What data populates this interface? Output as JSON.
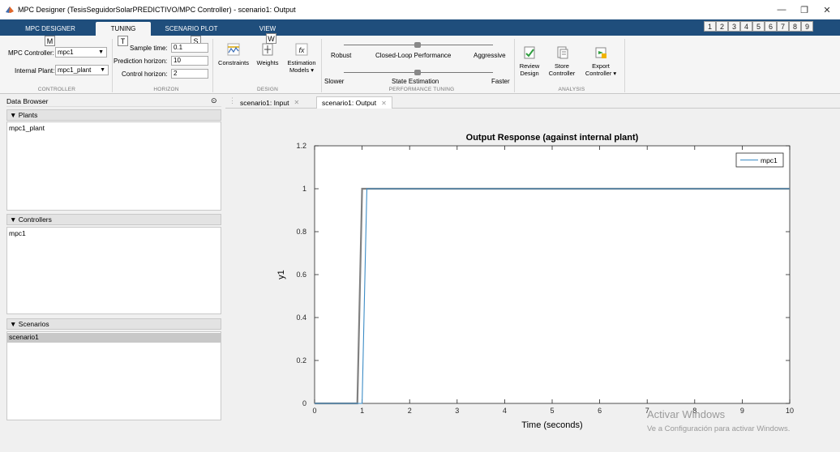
{
  "window": {
    "title": "MPC Designer (TesisSeguidorSolarPREDICTIVO/MPC Controller) - scenario1: Output",
    "minimize": "—",
    "maximize": "❐",
    "close": "✕"
  },
  "tabs": [
    {
      "label": "MPC DESIGNER"
    },
    {
      "label": "TUNING"
    },
    {
      "label": "SCENARIO PLOT"
    },
    {
      "label": "VIEW"
    }
  ],
  "quick_access_keys": [
    "1",
    "2",
    "3",
    "4",
    "5",
    "6",
    "7",
    "8",
    "9"
  ],
  "keytips": {
    "m": "M",
    "t": "T",
    "s": "S",
    "w": "W"
  },
  "ribbon": {
    "controller": {
      "mpc_controller_label": "MPC Controller:",
      "mpc_controller_value": "mpc1",
      "internal_plant_label": "Internal Plant:",
      "internal_plant_value": "mpc1_plant",
      "section": "CONTROLLER"
    },
    "horizon": {
      "sample_time_label": "Sample time:",
      "sample_time_value": "0.1",
      "prediction_label": "Prediction horizon:",
      "prediction_value": "10",
      "control_label": "Control horizon:",
      "control_value": "2",
      "section": "HORIZON"
    },
    "design": {
      "constraints": "Constraints",
      "weights": "Weights",
      "estimation_1": "Estimation",
      "estimation_2": "Models ▾",
      "section": "DESIGN"
    },
    "performance": {
      "robust": "Robust",
      "closed_loop": "Closed-Loop Performance",
      "aggressive": "Aggressive",
      "slower": "Slower",
      "state_estimation": "State Estimation",
      "faster": "Faster",
      "section": "PERFORMANCE TUNING"
    },
    "analysis": {
      "review_1": "Review",
      "review_2": "Design",
      "store_1": "Store",
      "store_2": "Controller",
      "export_1": "Export",
      "export_2": "Controller ▾",
      "section": "ANALYSIS"
    }
  },
  "data_browser": {
    "title": "Data Browser",
    "plants_header": "▼ Plants",
    "plants": [
      "mpc1_plant"
    ],
    "controllers_header": "▼ Controllers",
    "controllers": [
      "mpc1"
    ],
    "scenarios_header": "▼ Scenarios",
    "scenarios": [
      "scenario1"
    ]
  },
  "doc_tabs": [
    {
      "label": "scenario1: Input",
      "close": "✕"
    },
    {
      "label": "scenario1: Output",
      "close": "✕"
    }
  ],
  "watermark": {
    "line1": "Activar Windows",
    "line2": "Ve a Configuración para activar Windows."
  },
  "colors": {
    "reference_line": "#808080",
    "response_line": "#3c8cc6",
    "tab_strip": "#1f4e7c"
  },
  "chart_data": {
    "type": "line",
    "title": "Output Response (against internal plant)",
    "xlabel": "Time (seconds)",
    "ylabel": "y1",
    "xlim": [
      0,
      10
    ],
    "ylim": [
      0,
      1.2
    ],
    "xticks": [
      0,
      1,
      2,
      3,
      4,
      5,
      6,
      7,
      8,
      9,
      10
    ],
    "yticks": [
      0,
      0.2,
      0.4,
      0.6,
      0.8,
      1,
      1.2
    ],
    "ytick_labels": [
      "0",
      "0.2",
      "0.4",
      "0.6",
      "0.8",
      "1",
      "1.2"
    ],
    "legend": "top-right",
    "series": [
      {
        "name": "",
        "role": "reference",
        "color": "#808080",
        "x": [
          0,
          0.9,
          1.0,
          10
        ],
        "y": [
          0,
          0,
          1,
          1
        ]
      },
      {
        "name": "mpc1",
        "color": "#3c8cc6",
        "x": [
          0,
          1.0,
          1.1,
          10
        ],
        "y": [
          0,
          0,
          1,
          1
        ]
      }
    ]
  }
}
